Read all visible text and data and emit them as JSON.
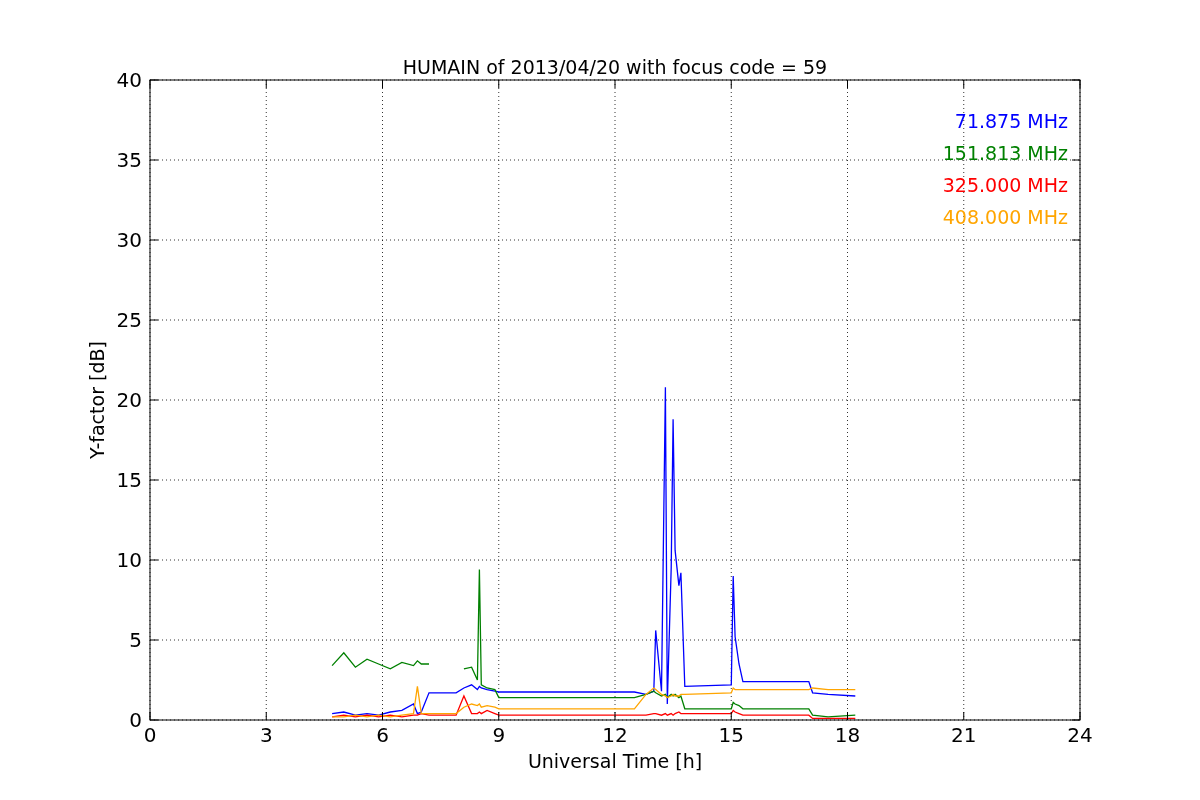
{
  "figure": {
    "chart_data": {
      "type": "line",
      "title": "HUMAIN of 2013/04/20 with focus code = 59",
      "xlabel": "Universal Time [h]",
      "ylabel": "Y-factor [dB]",
      "x": [
        4.7,
        5.0,
        5.3,
        5.6,
        5.9,
        6.2,
        6.5,
        6.8,
        6.9,
        7.0,
        7.2,
        7.5,
        7.9,
        8.1,
        8.3,
        8.45,
        8.5,
        8.55,
        8.7,
        8.9,
        9.0,
        12.5,
        12.8,
        13.0,
        13.05,
        13.2,
        13.3,
        13.35,
        13.45,
        13.5,
        13.55,
        13.65,
        13.7,
        13.8,
        15.0,
        15.05,
        15.1,
        15.2,
        15.3,
        17.0,
        17.1,
        17.5,
        18.2
      ],
      "series": [
        {
          "name": "71.875 MHz",
          "color": "#0000ff",
          "values": [
            0.4,
            0.5,
            0.3,
            0.4,
            0.3,
            0.5,
            0.6,
            1.0,
            0.4,
            0.5,
            1.7,
            1.7,
            1.7,
            2.0,
            2.2,
            1.9,
            2.1,
            2.0,
            1.9,
            1.8,
            1.75,
            1.75,
            1.6,
            1.8,
            5.6,
            1.8,
            20.8,
            1.0,
            9.5,
            18.8,
            10.6,
            8.4,
            9.2,
            2.1,
            2.2,
            9.0,
            5.2,
            3.5,
            2.4,
            2.4,
            1.7,
            1.6,
            1.5
          ]
        },
        {
          "name": "151.813 MHz",
          "color": "#008000",
          "values": [
            3.4,
            4.2,
            3.3,
            3.8,
            3.5,
            3.2,
            3.6,
            3.4,
            3.7,
            3.5,
            3.5,
            null,
            null,
            3.2,
            3.3,
            2.5,
            9.4,
            2.2,
            2.0,
            1.9,
            1.4,
            1.4,
            1.6,
            1.8,
            1.7,
            1.5,
            1.6,
            1.4,
            1.6,
            1.5,
            1.6,
            1.4,
            1.5,
            0.7,
            0.7,
            1.1,
            1.0,
            0.9,
            0.7,
            0.7,
            0.3,
            0.2,
            0.3
          ]
        },
        {
          "name": "325.000 MHz",
          "color": "#ff0000",
          "values": [
            0.2,
            0.3,
            0.2,
            0.3,
            0.2,
            0.3,
            0.2,
            0.3,
            0.3,
            0.4,
            0.3,
            0.3,
            0.3,
            1.5,
            0.4,
            0.4,
            0.5,
            0.4,
            0.6,
            0.4,
            0.3,
            0.3,
            0.3,
            0.4,
            0.4,
            0.3,
            0.4,
            0.3,
            0.4,
            0.3,
            0.4,
            0.5,
            0.4,
            0.4,
            0.4,
            0.6,
            0.5,
            0.4,
            0.3,
            0.3,
            0.1,
            0.1,
            0.1
          ]
        },
        {
          "name": "408.000 MHz",
          "color": "#ffa500",
          "values": [
            0.2,
            0.2,
            0.3,
            0.2,
            0.3,
            0.2,
            0.3,
            0.4,
            2.1,
            0.4,
            0.4,
            0.4,
            0.4,
            0.8,
            1.0,
            0.9,
            1.0,
            0.8,
            0.9,
            0.8,
            0.7,
            0.7,
            1.6,
            2.0,
            1.9,
            1.6,
            1.5,
            1.4,
            1.5,
            1.6,
            1.5,
            1.5,
            1.6,
            1.6,
            1.7,
            2.0,
            1.9,
            1.9,
            1.9,
            1.9,
            2.0,
            1.9,
            1.9
          ]
        }
      ],
      "xlim": [
        0,
        24
      ],
      "ylim": [
        0,
        40
      ],
      "xticks": [
        0,
        3,
        6,
        9,
        12,
        15,
        18,
        21,
        24
      ],
      "yticks": [
        0,
        5,
        10,
        15,
        20,
        25,
        30,
        35,
        40
      ],
      "grid": true
    }
  }
}
